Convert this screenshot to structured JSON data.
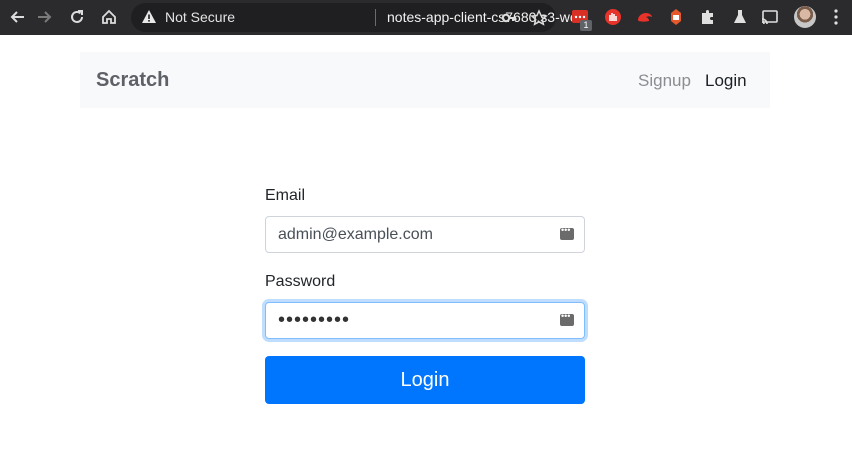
{
  "browser": {
    "security_label": "Not Secure",
    "url": "notes-app-client-cs7680.s3-we...",
    "extension_badge": "1",
    "icons": [
      "back-icon",
      "forward-icon",
      "reload-icon",
      "home-icon",
      "warning-icon",
      "key-icon",
      "star-icon",
      "extension-icon",
      "puzzle-icon",
      "lab-flask-icon",
      "cast-icon",
      "profile-avatar",
      "menu-icon"
    ]
  },
  "navbar": {
    "brand": "Scratch",
    "links": [
      {
        "label": "Signup"
      },
      {
        "label": "Login"
      }
    ]
  },
  "form": {
    "email_label": "Email",
    "email_value": "admin@example.com",
    "password_label": "Password",
    "password_mask": "•••••••••",
    "submit_label": "Login"
  },
  "colors": {
    "primary_button": "#0076ff",
    "navbar_bg": "#f8f9fa",
    "focus_border": "#80bdff",
    "chrome_bg": "#2b2b2d"
  }
}
